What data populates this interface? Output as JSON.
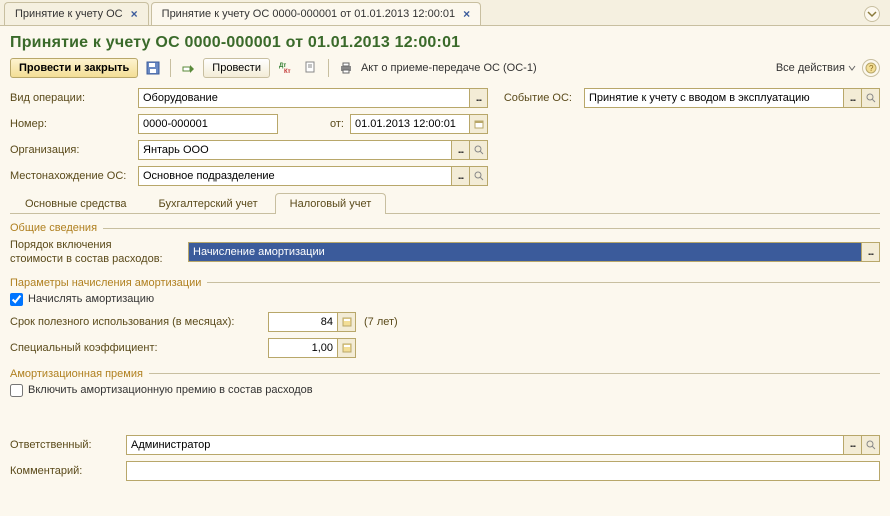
{
  "tabs": [
    {
      "label": "Принятие к учету ОС"
    },
    {
      "label": "Принятие к учету ОС 0000-000001 от 01.01.2013 12:00:01"
    }
  ],
  "title": "Принятие к учету ОС 0000-000001 от 01.01.2013 12:00:01",
  "toolbar": {
    "post_close": "Провести и закрыть",
    "post": "Провести",
    "act_report": "Акт о приеме-передаче ОС (ОС-1)",
    "all_actions": "Все действия"
  },
  "form": {
    "operation_type_label": "Вид операции:",
    "operation_type_value": "Оборудование",
    "event_label": "Событие ОС:",
    "event_value": "Принятие к учету с вводом в эксплуатацию",
    "number_label": "Номер:",
    "number_value": "0000-000001",
    "date_label": "от:",
    "date_value": "01.01.2013 12:00:01",
    "org_label": "Организация:",
    "org_value": "Янтарь ООО",
    "location_label": "Местонахождение ОС:",
    "location_value": "Основное подразделение"
  },
  "sub_tabs": [
    "Основные средства",
    "Бухгалтерский учет",
    "Налоговый учет"
  ],
  "tax": {
    "general_legend": "Общие сведения",
    "cost_order_label_l1": "Порядок включения",
    "cost_order_label_l2": "стоимости в состав расходов:",
    "cost_order_value": "Начисление амортизации",
    "amort_params_legend": "Параметры начисления амортизации",
    "calc_amort_checkbox": "Начислять амортизацию",
    "useful_life_label": "Срок полезного использования (в месяцах):",
    "useful_life_value": "84",
    "useful_life_hint": "(7 лет)",
    "special_coef_label": "Специальный коэффициент:",
    "special_coef_value": "1,00",
    "premium_legend": "Амортизационная премия",
    "premium_checkbox": "Включить амортизационную премию в состав расходов"
  },
  "bottom": {
    "responsible_label": "Ответственный:",
    "responsible_value": "Администратор",
    "comment_label": "Комментарий:",
    "comment_value": ""
  }
}
